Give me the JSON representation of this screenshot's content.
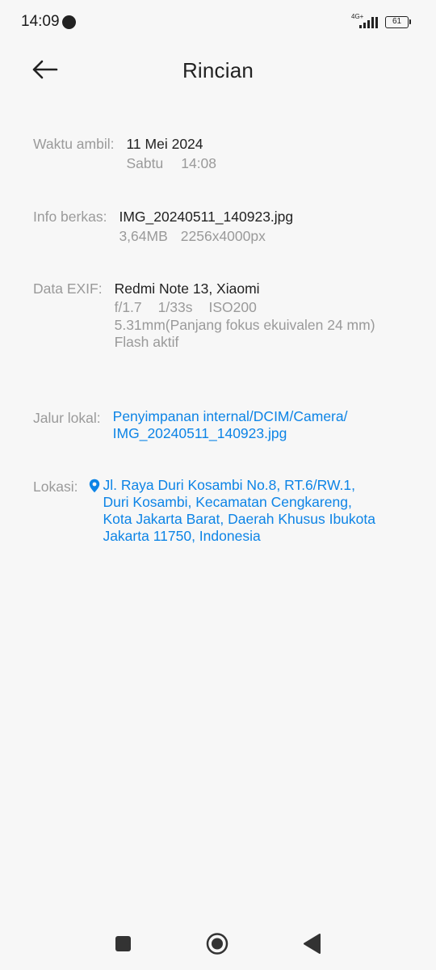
{
  "status": {
    "time": "14:09",
    "network": "4G+",
    "battery": "61"
  },
  "header": {
    "title": "Rincian"
  },
  "details": {
    "taken": {
      "label": "Waktu ambil:",
      "date": "11 Mei 2024",
      "day": "Sabtu",
      "time": "14:08"
    },
    "file": {
      "label": "Info berkas:",
      "name": "IMG_20240511_140923.jpg",
      "size": "3,64MB",
      "resolution": "2256x4000px"
    },
    "exif": {
      "label": "Data EXIF:",
      "device": "Redmi Note 13, Xiaomi",
      "aperture": "f/1.7",
      "shutter": "1/33s",
      "iso": "ISO200",
      "focal": "5.31mm(Panjang fokus ekuivalen 24 mm)",
      "flash": "Flash aktif"
    },
    "path": {
      "label": "Jalur lokal:",
      "line1": "Penyimpanan internal/DCIM/Camera/",
      "line2": "IMG_20240511_140923.jpg"
    },
    "location": {
      "label": "Lokasi:",
      "line1": "Jl. Raya Duri Kosambi No.8, RT.6/RW.1,",
      "line2": "Duri Kosambi, Kecamatan Cengkareng,",
      "line3": "Kota Jakarta Barat, Daerah Khusus Ibukota",
      "line4": "Jakarta 11750, Indonesia"
    }
  },
  "colors": {
    "link": "#0d84e6",
    "label": "#9a9a9a",
    "text": "#222222",
    "background": "#f7f7f7"
  },
  "icons": {
    "back": "arrow-left-icon",
    "location": "location-pin-icon",
    "nav_recents": "square-icon",
    "nav_home": "circle-icon",
    "nav_back": "triangle-back-icon"
  }
}
